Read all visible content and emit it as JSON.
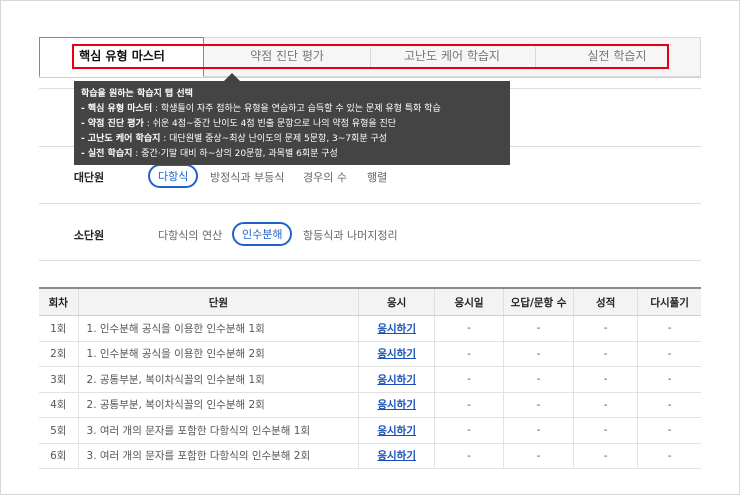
{
  "tabs": [
    {
      "label": "핵심 유형 마스터",
      "active": true
    },
    {
      "label": "약점 진단 평가",
      "active": false
    },
    {
      "label": "고난도 케어 학습지",
      "active": false
    },
    {
      "label": "실전 학습지",
      "active": false
    }
  ],
  "tooltip": {
    "title": "학습을 원하는 학습지 탭 선택",
    "lines": [
      {
        "name": "- 핵심 유형 마스터",
        "desc": " : 학생들이 자주 접하는 유형을 연습하고 습득할 수 있는 문제 유형 특화 학습"
      },
      {
        "name": "- 약점 진단 평가",
        "desc": " : 쉬운 4점~중간 난이도 4점 빈출 문항으로 나의 약점 유형을 진단"
      },
      {
        "name": "- 고난도 케어 학습지",
        "desc": " : 대단원별 중상~최상 난이도의 문제 5문항, 3~7회분 구성"
      },
      {
        "name": "- 실전 학습지",
        "desc": " : 중간·기말 대비 하~상의 20문항, 과목별 6회분 구성"
      }
    ]
  },
  "filters": {
    "major": {
      "label": "대단원",
      "options": [
        "다항식",
        "방정식과 부등식",
        "경우의 수",
        "행렬"
      ],
      "selected": 0
    },
    "minor": {
      "label": "소단원",
      "options": [
        "다항식의 연산",
        "인수분해",
        "항등식과 나머지정리"
      ],
      "selected": 1
    }
  },
  "table": {
    "headers": [
      "회차",
      "단원",
      "응시",
      "응시일",
      "오답/문항 수",
      "성적",
      "다시풀기"
    ],
    "rows": [
      {
        "round": "1회",
        "unit": "1. 인수분해 공식을 이용한 인수분해 1회",
        "action": "응시하기",
        "date": "-",
        "wrong": "-",
        "score": "-",
        "retry": "-"
      },
      {
        "round": "2회",
        "unit": "1. 인수분해 공식을 이용한 인수분해 2회",
        "action": "응시하기",
        "date": "-",
        "wrong": "-",
        "score": "-",
        "retry": "-"
      },
      {
        "round": "3회",
        "unit": "2. 공통부분, 복이차식꼴의 인수분해 1회",
        "action": "응시하기",
        "date": "-",
        "wrong": "-",
        "score": "-",
        "retry": "-"
      },
      {
        "round": "4회",
        "unit": "2. 공통부분, 복이차식꼴의 인수분해 2회",
        "action": "응시하기",
        "date": "-",
        "wrong": "-",
        "score": "-",
        "retry": "-"
      },
      {
        "round": "5회",
        "unit": "3. 여러 개의 문자를 포함한 다항식의 인수분해 1회",
        "action": "응시하기",
        "date": "-",
        "wrong": "-",
        "score": "-",
        "retry": "-"
      },
      {
        "round": "6회",
        "unit": "3. 여러 개의 문자를 포함한 다항식의 인수분해 2회",
        "action": "응시하기",
        "date": "-",
        "wrong": "-",
        "score": "-",
        "retry": "-"
      }
    ]
  },
  "colors": {
    "highlight": "#e60012",
    "accent": "#1e62c9",
    "link": "#1650b8",
    "tooltip_bg": "#444444"
  }
}
